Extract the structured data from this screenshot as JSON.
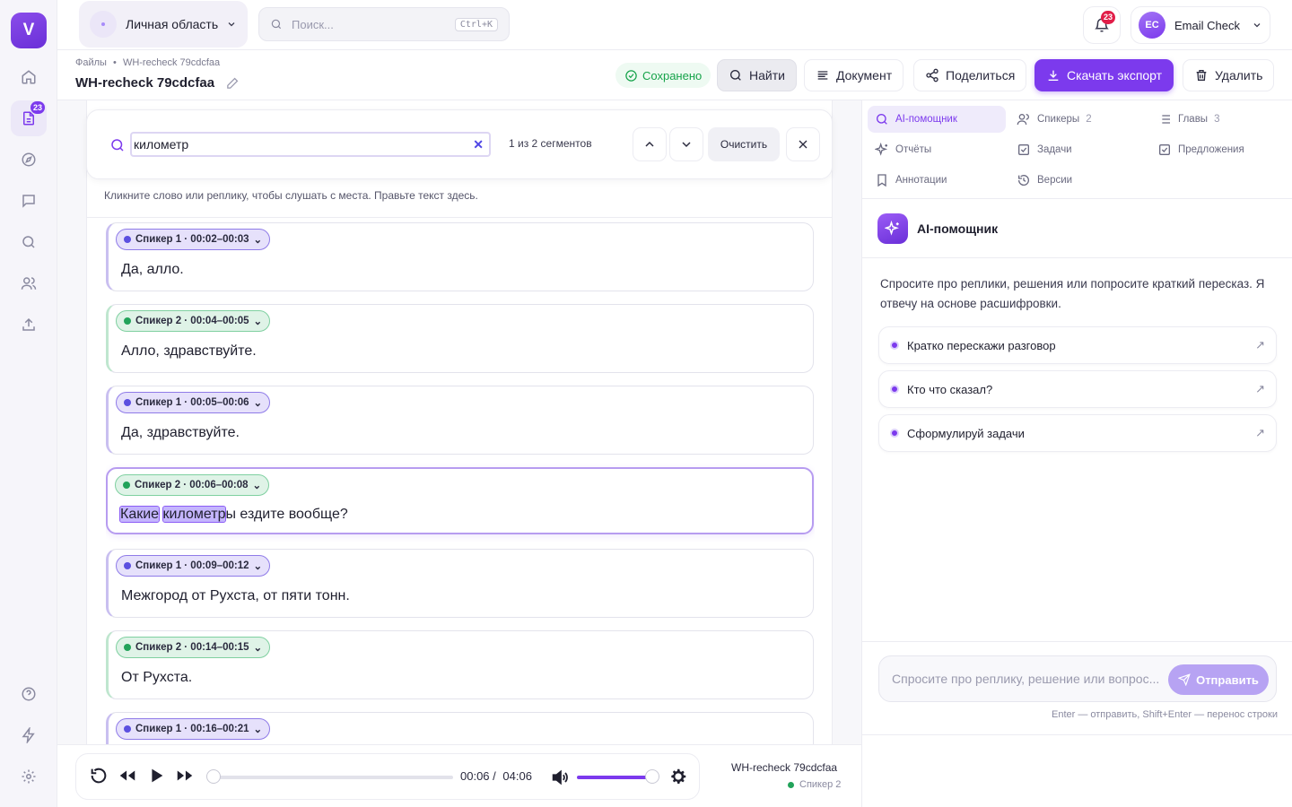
{
  "sidebar": {
    "logo": "V",
    "docs_badge": "23"
  },
  "topbar": {
    "workspace_label": "Личная область",
    "search_placeholder": "Поиск...",
    "search_shortcut": "Ctrl+K",
    "notifications_count": "23",
    "user_initials": "EC",
    "user_name": "Email Check"
  },
  "doc": {
    "breadcrumb_root": "Файлы",
    "breadcrumb_sep": "•",
    "breadcrumb_current": "WH-recheck 79cdcfaa",
    "title": "WH-recheck 79cdcfaa",
    "saved_label": "Сохранено"
  },
  "actions": {
    "find": "Найти",
    "document": "Документ",
    "share": "Поделиться",
    "export": "Скачать экспорт",
    "delete": "Удалить"
  },
  "find_bar": {
    "query": "километр",
    "count": "1 из 2 сегментов",
    "clear": "Очистить"
  },
  "hint": "Кликните слово или реплику, чтобы слушать с места. Правьте текст здесь.",
  "segments": [
    {
      "speaker": "Спикер 1 · 00:02–00:03",
      "text": "Да, алло.",
      "spk": 1
    },
    {
      "speaker": "Спикер 2 · 00:04–00:05",
      "text": "Алло, здравствуйте.",
      "spk": 2
    },
    {
      "speaker": "Спикер 1 · 00:05–00:06",
      "text": "Да, здравствуйте.",
      "spk": 1
    },
    {
      "speaker": "Спикер 2 · 00:06–00:08",
      "text_hl1": "Какие",
      "text_hl2": "километр",
      "text_rest": "ы ездите вообще?",
      "spk": 2
    },
    {
      "speaker": "Спикер 1 · 00:09–00:12",
      "text": "Межгород от Рухста, от пяти тонн.",
      "spk": 1
    },
    {
      "speaker": "Спикер 2 · 00:14–00:15",
      "text": "От Рухста.",
      "spk": 2
    },
    {
      "speaker": "Спикер 1 · 00:16–00:21",
      "text": "",
      "spk": 1
    }
  ],
  "player": {
    "current": "00:06",
    "sep": "/",
    "total": "04:06",
    "progress_fraction": 0.02,
    "volume_fraction": 1.0,
    "file_name": "WH-recheck 79cdcfaa",
    "speaker": "Спикер 2"
  },
  "right_tabs": [
    {
      "label": "AI-помощник",
      "count": ""
    },
    {
      "label": "Спикеры",
      "count": "2"
    },
    {
      "label": "Главы",
      "count": "3"
    },
    {
      "label": "Отчёты",
      "count": ""
    },
    {
      "label": "Задачи",
      "count": ""
    },
    {
      "label": "Предложения",
      "count": ""
    },
    {
      "label": "Аннотации",
      "count": ""
    },
    {
      "label": "Версии",
      "count": ""
    }
  ],
  "assistant": {
    "title": "AI-помощник",
    "description": "Спросите про реплики, решения или попросите краткий пересказ. Я отвечу на основе расшифровки.",
    "suggestions": [
      "Кратко перескажи разговор",
      "Кто что сказал?",
      "Сформулируй задачи"
    ],
    "input_placeholder": "Спросите про реплику, решение или вопрос...",
    "send_label": "Отправить",
    "hint": "Enter — отправить, Shift+Enter — перенос строки"
  },
  "colors": {
    "accent": "#7c3aed",
    "speaker1": "#5b4fe0",
    "speaker2": "#22a35a",
    "saved": "#16a34a",
    "alert": "#e11d48"
  }
}
